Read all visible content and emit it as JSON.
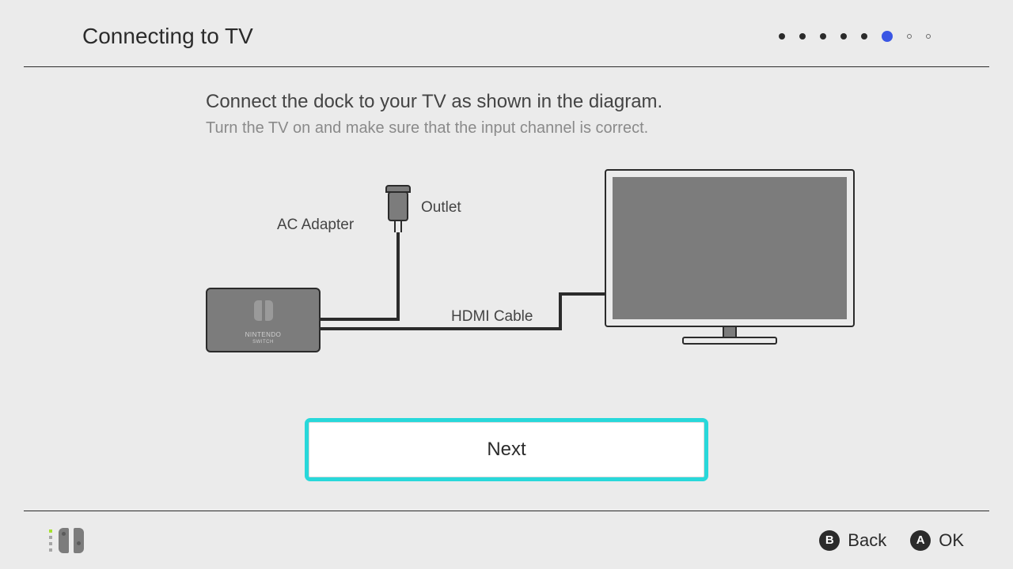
{
  "header": {
    "title": "Connecting to TV",
    "progress": {
      "total": 8,
      "current_index": 5
    }
  },
  "content": {
    "headline": "Connect the dock to your TV as shown in the diagram.",
    "sub": "Turn the TV on and make sure that the input channel is correct.",
    "labels": {
      "outlet": "Outlet",
      "ac_adapter": "AC Adapter",
      "hdmi": "HDMI Cable",
      "dock_brand_top": "NINTENDO",
      "dock_brand_bottom": "SWITCH"
    },
    "next_button": "Next"
  },
  "footer": {
    "hints": [
      {
        "button": "B",
        "label": "Back"
      },
      {
        "button": "A",
        "label": "OK"
      }
    ]
  }
}
